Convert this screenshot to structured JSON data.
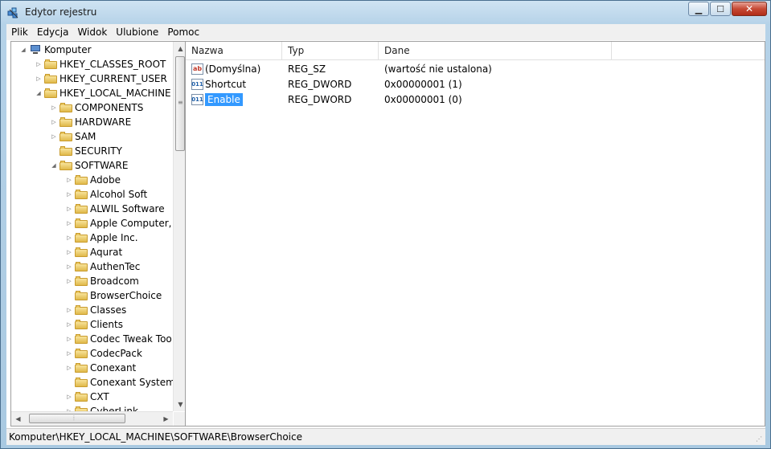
{
  "window": {
    "title": "Edytor rejestru"
  },
  "menu": [
    "Plik",
    "Edycja",
    "Widok",
    "Ulubione",
    "Pomoc"
  ],
  "tree": [
    {
      "label": "Komputer",
      "level": 0,
      "expander": "expanded",
      "icon": "computer"
    },
    {
      "label": "HKEY_CLASSES_ROOT",
      "level": 1,
      "expander": "collapsed",
      "icon": "folder"
    },
    {
      "label": "HKEY_CURRENT_USER",
      "level": 1,
      "expander": "collapsed",
      "icon": "folder"
    },
    {
      "label": "HKEY_LOCAL_MACHINE",
      "level": 1,
      "expander": "expanded",
      "icon": "folder"
    },
    {
      "label": "COMPONENTS",
      "level": 2,
      "expander": "collapsed",
      "icon": "folder"
    },
    {
      "label": "HARDWARE",
      "level": 2,
      "expander": "collapsed",
      "icon": "folder"
    },
    {
      "label": "SAM",
      "level": 2,
      "expander": "collapsed",
      "icon": "folder"
    },
    {
      "label": "SECURITY",
      "level": 2,
      "expander": "none",
      "icon": "folder"
    },
    {
      "label": "SOFTWARE",
      "level": 2,
      "expander": "expanded",
      "icon": "folder"
    },
    {
      "label": "Adobe",
      "level": 3,
      "expander": "collapsed",
      "icon": "folder"
    },
    {
      "label": "Alcohol Soft",
      "level": 3,
      "expander": "collapsed",
      "icon": "folder"
    },
    {
      "label": "ALWIL Software",
      "level": 3,
      "expander": "collapsed",
      "icon": "folder"
    },
    {
      "label": "Apple Computer, I",
      "level": 3,
      "expander": "collapsed",
      "icon": "folder"
    },
    {
      "label": "Apple Inc.",
      "level": 3,
      "expander": "collapsed",
      "icon": "folder"
    },
    {
      "label": "Aqurat",
      "level": 3,
      "expander": "collapsed",
      "icon": "folder"
    },
    {
      "label": "AuthenTec",
      "level": 3,
      "expander": "collapsed",
      "icon": "folder"
    },
    {
      "label": "Broadcom",
      "level": 3,
      "expander": "collapsed",
      "icon": "folder"
    },
    {
      "label": "BrowserChoice",
      "level": 3,
      "expander": "none",
      "icon": "folder"
    },
    {
      "label": "Classes",
      "level": 3,
      "expander": "collapsed",
      "icon": "folder"
    },
    {
      "label": "Clients",
      "level": 3,
      "expander": "collapsed",
      "icon": "folder"
    },
    {
      "label": "Codec Tweak Too",
      "level": 3,
      "expander": "collapsed",
      "icon": "folder"
    },
    {
      "label": "CodecPack",
      "level": 3,
      "expander": "collapsed",
      "icon": "folder"
    },
    {
      "label": "Conexant",
      "level": 3,
      "expander": "collapsed",
      "icon": "folder"
    },
    {
      "label": "Conexant Systems",
      "level": 3,
      "expander": "none",
      "icon": "folder"
    },
    {
      "label": "CXT",
      "level": 3,
      "expander": "collapsed",
      "icon": "folder"
    },
    {
      "label": "CyberLink",
      "level": 3,
      "expander": "collapsed",
      "icon": "folder"
    }
  ],
  "columns": {
    "name": "Nazwa",
    "type": "Typ",
    "data": "Dane"
  },
  "values": [
    {
      "name": "(Domyślna)",
      "type": "REG_SZ",
      "data": "(wartość nie ustalona)",
      "icon": "string-value-icon",
      "icon_text": "ab",
      "selected": false
    },
    {
      "name": "Shortcut",
      "type": "REG_DWORD",
      "data": "0x00000001 (1)",
      "icon": "binary-value-icon",
      "icon_text": "011",
      "selected": false
    },
    {
      "name": "Enable",
      "type": "REG_DWORD",
      "data": "0x00000001 (0)",
      "icon": "binary-value-icon",
      "icon_text": "011",
      "selected": true
    }
  ],
  "status": {
    "path": "Komputer\\HKEY_LOCAL_MACHINE\\SOFTWARE\\BrowserChoice"
  },
  "colors": {
    "selection": "#3399ff",
    "chrome": "#b5d2e8"
  }
}
